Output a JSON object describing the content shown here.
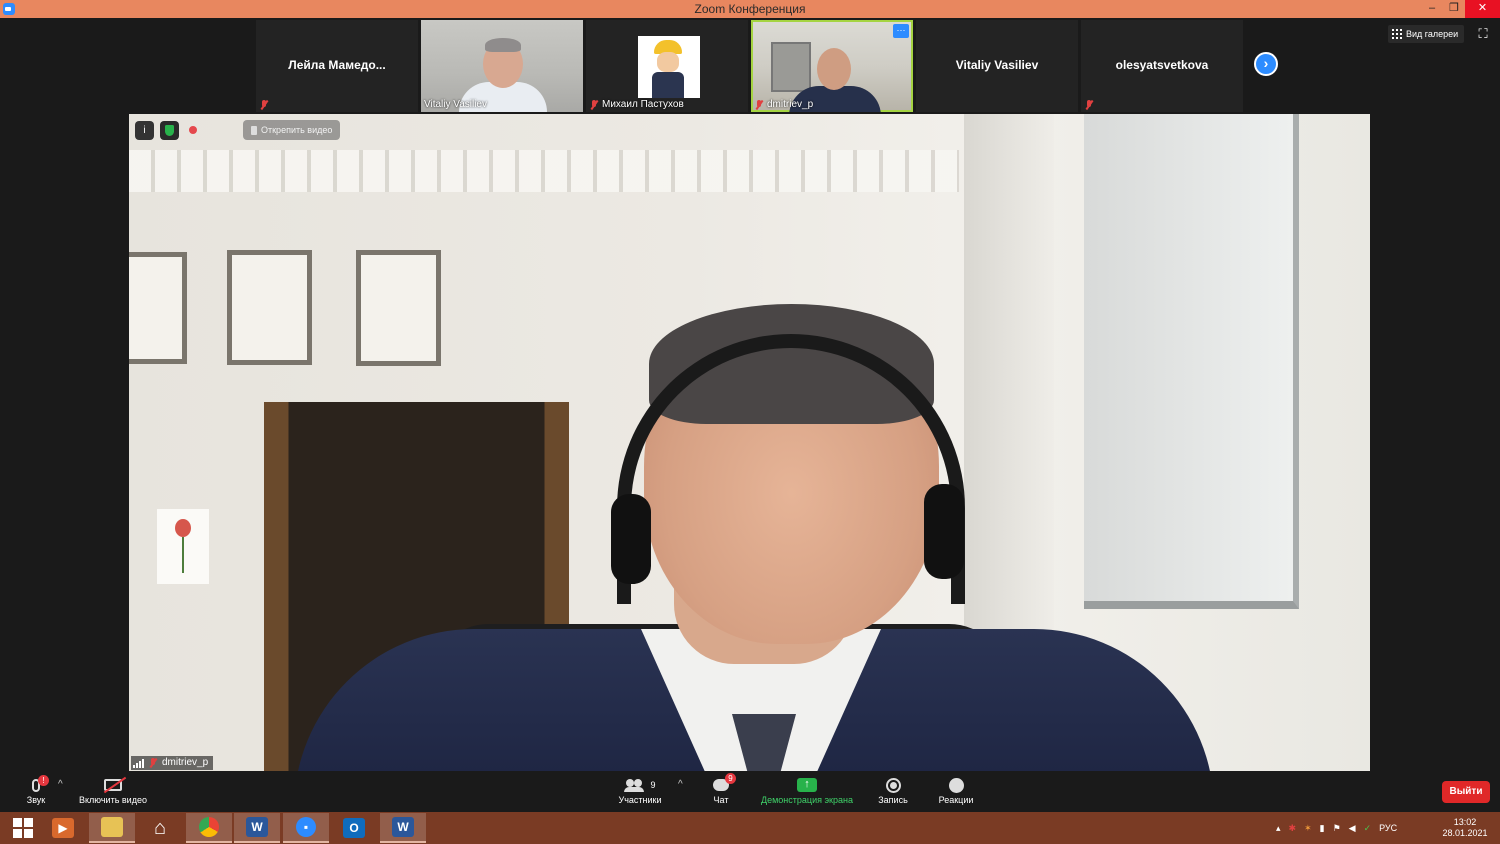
{
  "window": {
    "title": "Zoom Конференция"
  },
  "participants": [
    {
      "name": "Лейла  Мамедо...",
      "type": "name-only",
      "muted": true
    },
    {
      "name": "Vitaliy Vasiliev",
      "type": "video",
      "muted": false
    },
    {
      "name": "Михаил Пастухов",
      "type": "avatar",
      "muted": true
    },
    {
      "name": "dmitriev_p",
      "type": "video",
      "muted": true,
      "active_speaker": true
    },
    {
      "name": "Vitaliy Vasiliev",
      "type": "name-only",
      "muted": false
    },
    {
      "name": "olesyatsvetkova",
      "type": "name-only",
      "muted": true
    }
  ],
  "strip_controls": {
    "more": "···",
    "next": "›"
  },
  "view": {
    "gallery_label": "Вид галереи",
    "fullscreen": "⛶"
  },
  "speaker": {
    "name": "dmitriev_p",
    "info": "i",
    "unpin_label": "Открепить видео"
  },
  "toolbar": {
    "audio_label": "Звук",
    "audio_badge": "!",
    "video_label": "Включить видео",
    "participants_label": "Участники",
    "participants_count": "9",
    "chat_label": "Чат",
    "chat_badge": "9",
    "share_label": "Демонстрация экрана",
    "record_label": "Запись",
    "reactions_label": "Реакции",
    "leave_label": "Выйти",
    "caret": "^"
  },
  "taskbar": {
    "language": "РУС",
    "time": "13:02",
    "date": "28.01.2021"
  },
  "colors": {
    "titlebar": "#e8875f",
    "zoom_blue": "#2d8cff",
    "share_green": "#28b24b",
    "leave_red": "#e02828",
    "taskbar": "#7a3b24"
  }
}
